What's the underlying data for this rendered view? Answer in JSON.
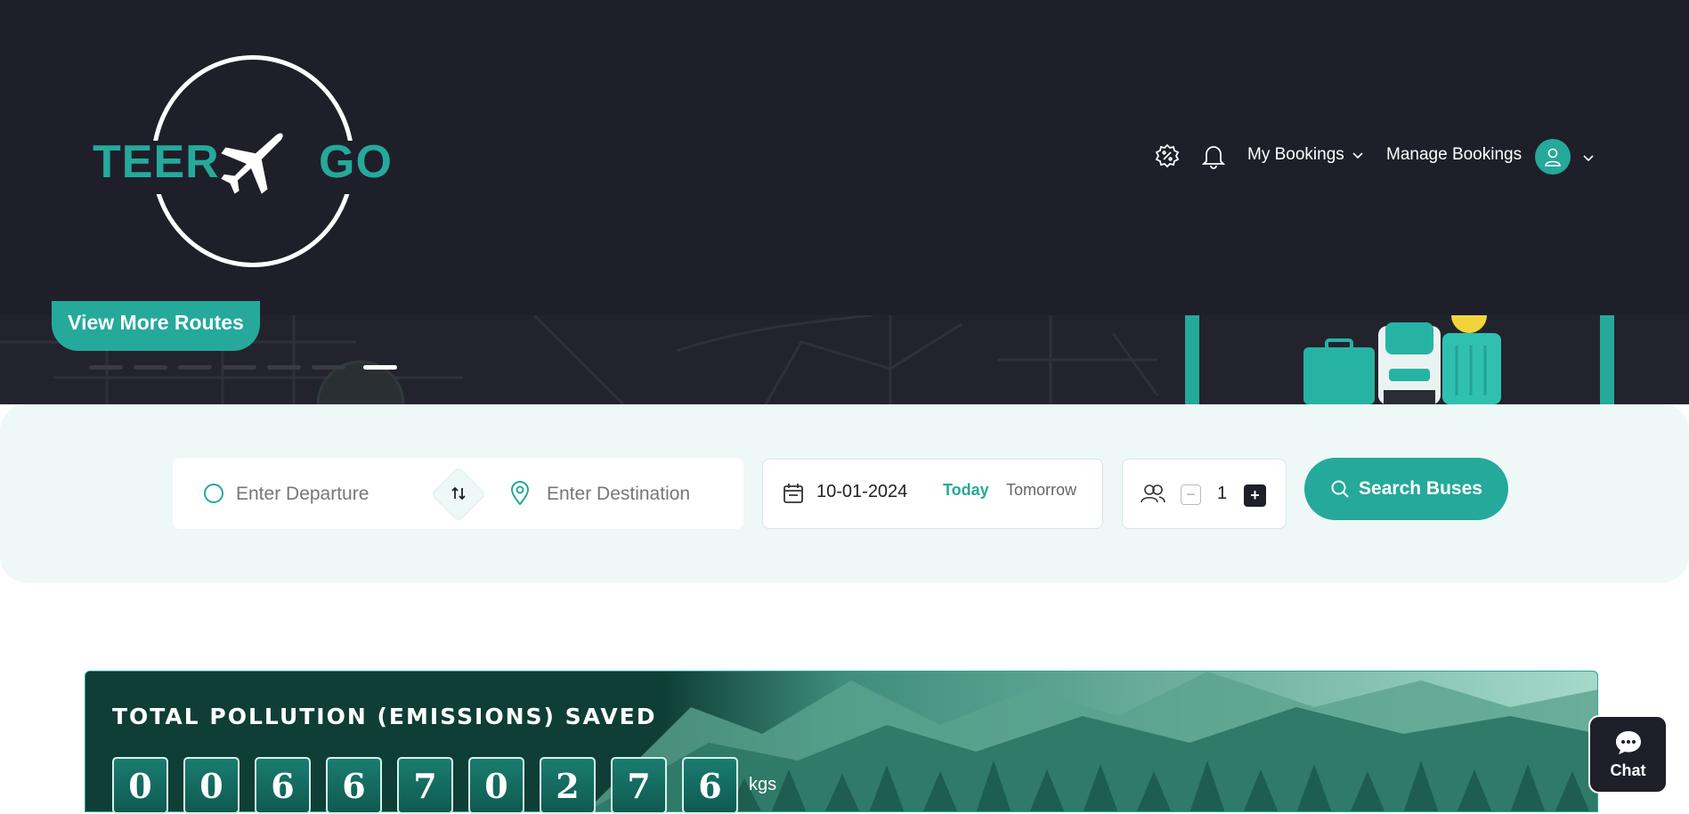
{
  "logo": {
    "word_left": "TEER",
    "word_right": "GO"
  },
  "nav": {
    "offers_icon": "discount-badge-icon",
    "notifications_icon": "bell-icon",
    "my_bookings": "My Bookings",
    "manage_bookings": "Manage Bookings",
    "profile_icon": "user-icon"
  },
  "banner": {
    "view_more": "View More Routes",
    "slides_count": 7,
    "active_slide": 7
  },
  "search": {
    "departure_placeholder": "Enter Departure",
    "destination_placeholder": "Enter Destination",
    "date": "10-01-2024",
    "today": "Today",
    "tomorrow": "Tomorrow",
    "passengers": "1",
    "minus": "−",
    "plus": "+",
    "button": "Search Buses"
  },
  "pollution": {
    "title": "TOTAL POLLUTION (EMISSIONS) SAVED",
    "digits": [
      "0",
      "0",
      "6",
      "6",
      "7",
      "0",
      "2",
      "7",
      "6"
    ],
    "unit": "kgs"
  },
  "chat": {
    "label": "Chat"
  },
  "colors": {
    "accent": "#25a99b",
    "header_bg": "#1f1f2a",
    "panel_bg": "#eef8f6"
  }
}
